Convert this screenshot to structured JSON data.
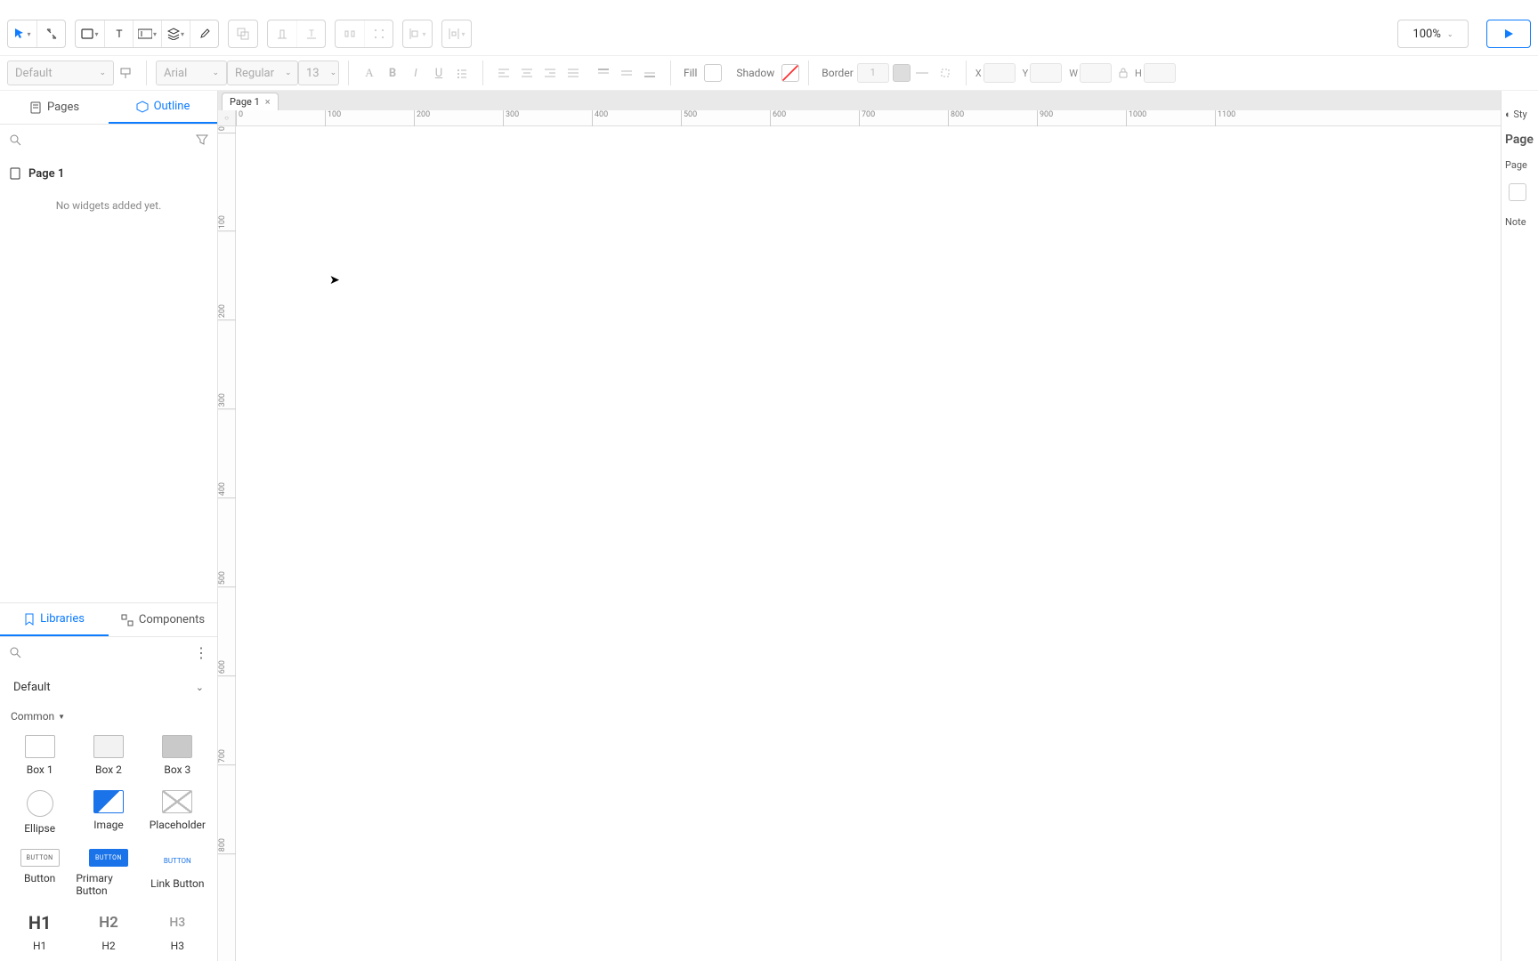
{
  "toolbar": {
    "zoom": "100%",
    "style_select": "Default",
    "font_family": "Arial",
    "font_weight": "Regular",
    "font_size": "13",
    "fill_label": "Fill",
    "shadow_label": "Shadow",
    "border_label": "Border",
    "border_width": "1",
    "pos_x_label": "X",
    "pos_y_label": "Y",
    "size_w_label": "W",
    "size_h_label": "H"
  },
  "left": {
    "pages_tab": "Pages",
    "outline_tab": "Outline",
    "tree_root": "Page 1",
    "empty_msg": "No widgets added yet.",
    "libraries_tab": "Libraries",
    "components_tab": "Components",
    "library_select": "Default",
    "category": "Common",
    "widgets": [
      {
        "name": "Box 1",
        "class": "box1"
      },
      {
        "name": "Box 2",
        "class": "box2"
      },
      {
        "name": "Box 3",
        "class": "box3"
      },
      {
        "name": "Ellipse",
        "class": "ellipse"
      },
      {
        "name": "Image",
        "class": "image"
      },
      {
        "name": "Placeholder",
        "class": "placeholder"
      },
      {
        "name": "Button",
        "class": "btn",
        "thumb_text": "BUTTON"
      },
      {
        "name": "Primary Button",
        "class": "btn btn-primary",
        "thumb_text": "BUTTON"
      },
      {
        "name": "Link Button",
        "class": "btn-link",
        "thumb_text": "BUTTON"
      },
      {
        "name": "H1",
        "class": "h1",
        "thumb_text": "H1"
      },
      {
        "name": "H2",
        "class": "h2",
        "thumb_text": "H2"
      },
      {
        "name": "H3",
        "class": "h3",
        "thumb_text": "H3"
      }
    ]
  },
  "canvas": {
    "page_tab": "Page 1",
    "ruler_h": [
      0,
      100,
      200,
      300,
      400,
      500,
      600,
      700,
      800,
      900,
      1000,
      1100
    ],
    "ruler_v": [
      0,
      100,
      200,
      300,
      400,
      500,
      600,
      700,
      800
    ]
  },
  "right": {
    "style_label": "Sty",
    "heading": "Page",
    "page_label": "Page",
    "notes_label": "Note"
  }
}
